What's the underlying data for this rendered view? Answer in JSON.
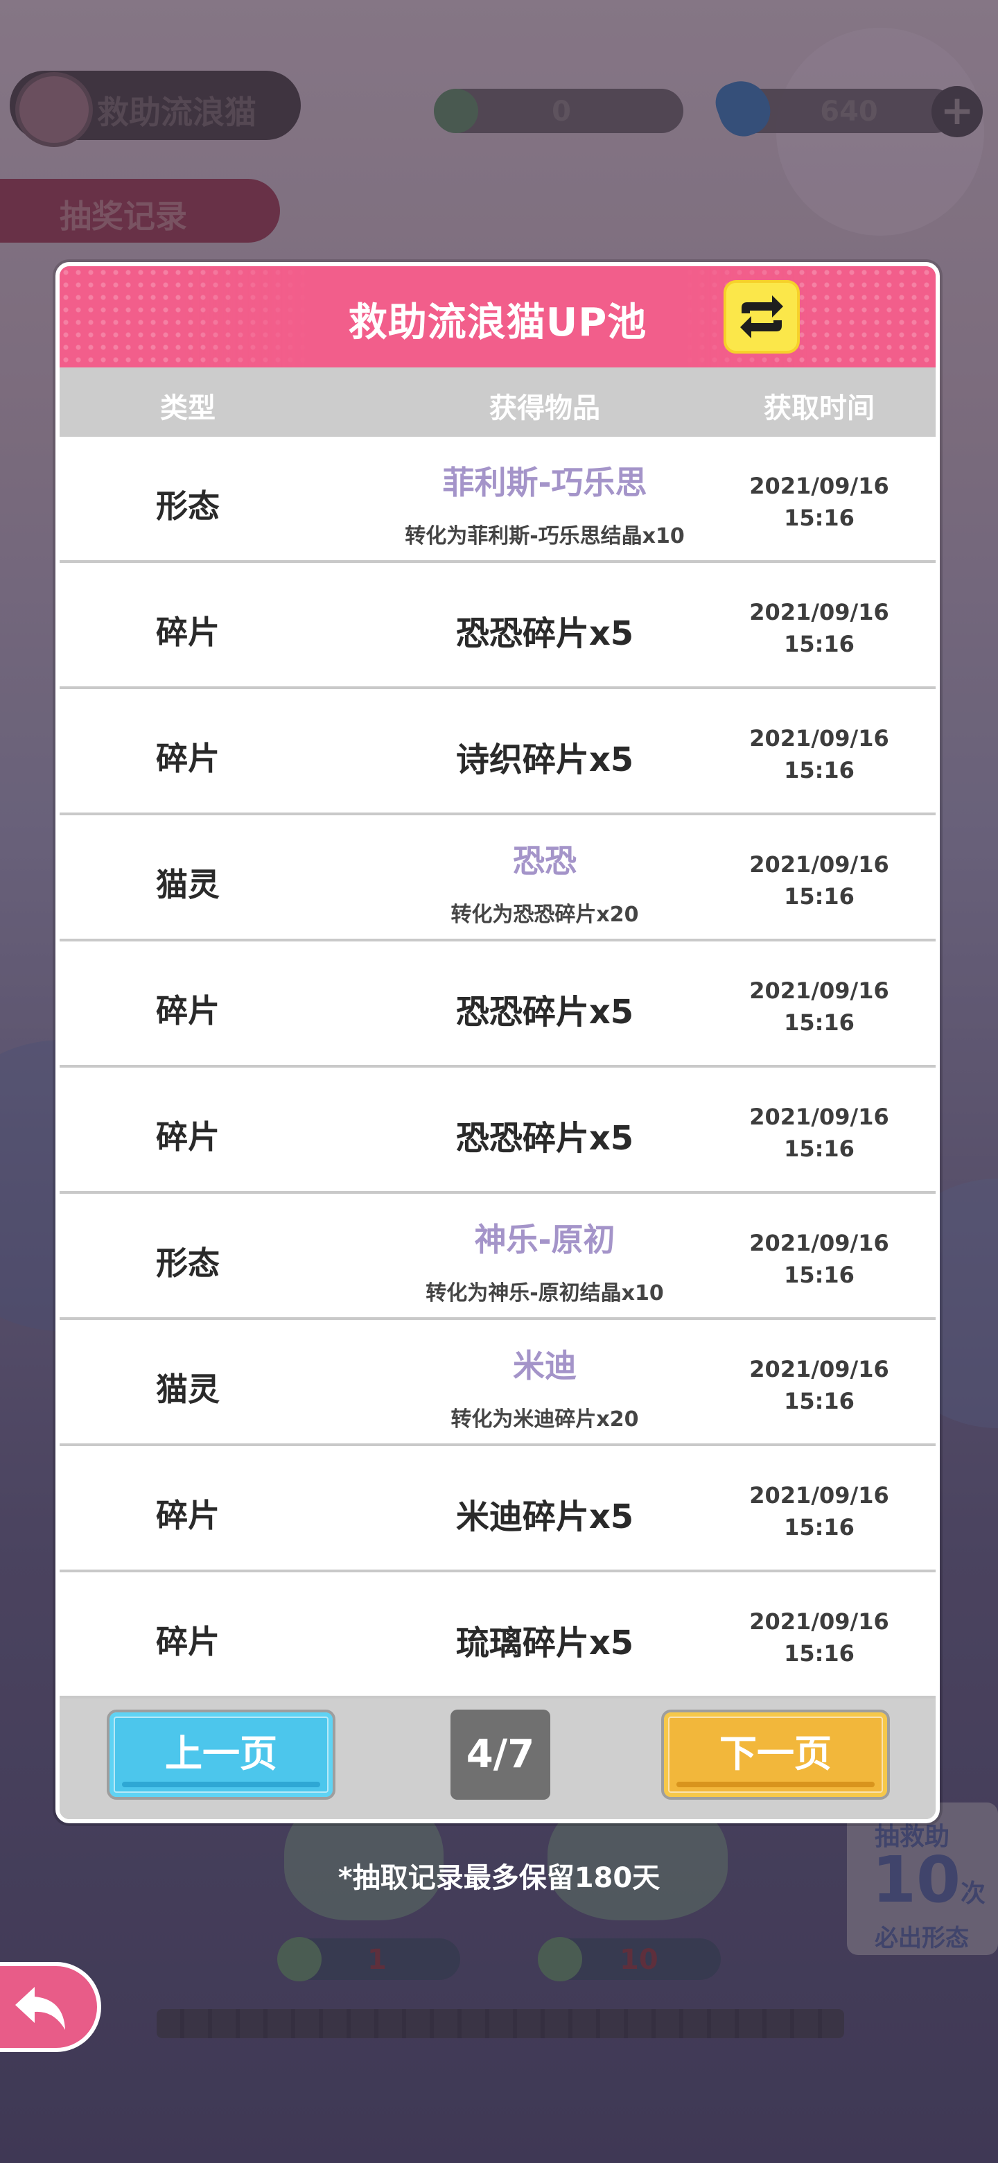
{
  "topbar": {
    "title": "救助流浪猫",
    "currency_a_value": "0",
    "currency_b_value": "640",
    "plus_label": "+"
  },
  "record_tab_label": "抽奖记录",
  "modal": {
    "title": "救助流浪猫UP池",
    "columns": {
      "type": "类型",
      "item": "获得物品",
      "time": "获取时间"
    },
    "rows": [
      {
        "type": "形态",
        "item": "菲利斯-巧乐思",
        "sub": "转化为菲利斯-巧乐思结晶x10",
        "date": "2021/09/16",
        "time": "15:16"
      },
      {
        "type": "碎片",
        "item": "恐恐碎片x5",
        "sub": "",
        "date": "2021/09/16",
        "time": "15:16"
      },
      {
        "type": "碎片",
        "item": "诗织碎片x5",
        "sub": "",
        "date": "2021/09/16",
        "time": "15:16"
      },
      {
        "type": "猫灵",
        "item": "恐恐",
        "sub": "转化为恐恐碎片x20",
        "date": "2021/09/16",
        "time": "15:16"
      },
      {
        "type": "碎片",
        "item": "恐恐碎片x5",
        "sub": "",
        "date": "2021/09/16",
        "time": "15:16"
      },
      {
        "type": "碎片",
        "item": "恐恐碎片x5",
        "sub": "",
        "date": "2021/09/16",
        "time": "15:16"
      },
      {
        "type": "形态",
        "item": "神乐-原初",
        "sub": "转化为神乐-原初结晶x10",
        "date": "2021/09/16",
        "time": "15:16"
      },
      {
        "type": "猫灵",
        "item": "米迪",
        "sub": "转化为米迪碎片x20",
        "date": "2021/09/16",
        "time": "15:16"
      },
      {
        "type": "碎片",
        "item": "米迪碎片x5",
        "sub": "",
        "date": "2021/09/16",
        "time": "15:16"
      },
      {
        "type": "碎片",
        "item": "琉璃碎片x5",
        "sub": "",
        "date": "2021/09/16",
        "time": "15:16"
      }
    ],
    "pager": {
      "prev_label": "上一页",
      "next_label": "下一页",
      "page_indicator": "4/7"
    }
  },
  "background": {
    "ticket_line1": "抽救助",
    "ticket_number": "10",
    "ticket_unit": "次",
    "ticket_line3": "必出形态",
    "cost_single": "1",
    "cost_ten": "10"
  },
  "note": "*抽取记录最多保留180天",
  "icons": {
    "switch": "swap-arrows-icon",
    "back": "back-arrow-icon",
    "gem": "gem-icon",
    "coin": "coin-icon"
  },
  "colors": {
    "header_pink": "#f25e8b",
    "highlight_purple": "#a494c9",
    "prev_blue": "#4cc6ec",
    "next_orange": "#f2b73b",
    "switch_yellow": "#fbe74a"
  }
}
